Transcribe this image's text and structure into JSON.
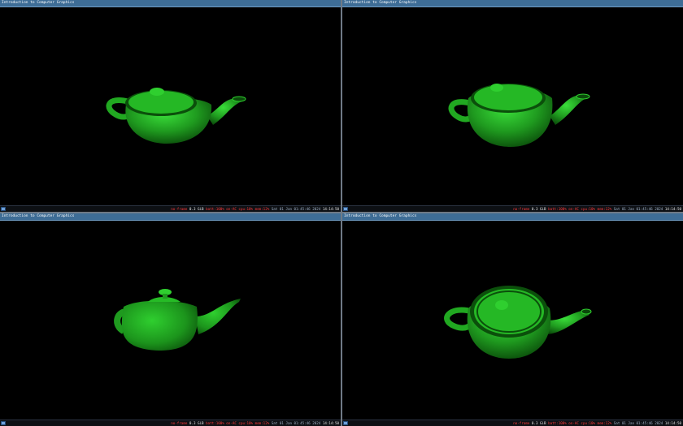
{
  "window_title": "Introduction to Computer Graphics",
  "panes": [
    {
      "title": "Introduction to Computer Graphics",
      "status": {
        "left": "no-frame",
        "mid": "0.3 GiB",
        "detail": "batt:100% on-AC  cpu:10% mem:12%",
        "date": "Sat 01 Jan 01:45:46 2024",
        "time": "14:14:50"
      }
    },
    {
      "title": "Introduction to Computer Graphics",
      "status": {
        "left": "no-frame",
        "mid": "0.3 GiB",
        "detail": "batt:100% on-AC  cpu:10% mem:12%",
        "date": "Sat 01 Jan 01:45:46 2024",
        "time": "14:14:50"
      }
    },
    {
      "title": "Introduction to Computer Graphics",
      "status": {
        "left": "no-frame",
        "mid": "0.3 GiB",
        "detail": "batt:100% on-AC  cpu:10% mem:12%",
        "date": "Sat 01 Jan 01:45:46 2024",
        "time": "14:14:50"
      }
    },
    {
      "title": "Introduction to Computer Graphics",
      "status": {
        "left": "no-frame",
        "mid": "0.3 GiB",
        "detail": "batt:100% on-AC  cpu:10% mem:12%",
        "date": "Sat 01 Jan 01:45:46 2024",
        "time": "14:14:50"
      }
    }
  ],
  "colors": {
    "background": "#000000",
    "teapot": "#1f9a1f",
    "teapot_highlight": "#35d135",
    "teapot_shadow": "#0a4a0a",
    "titlebar": "#3e6d96",
    "divider": "#6f7a86"
  }
}
